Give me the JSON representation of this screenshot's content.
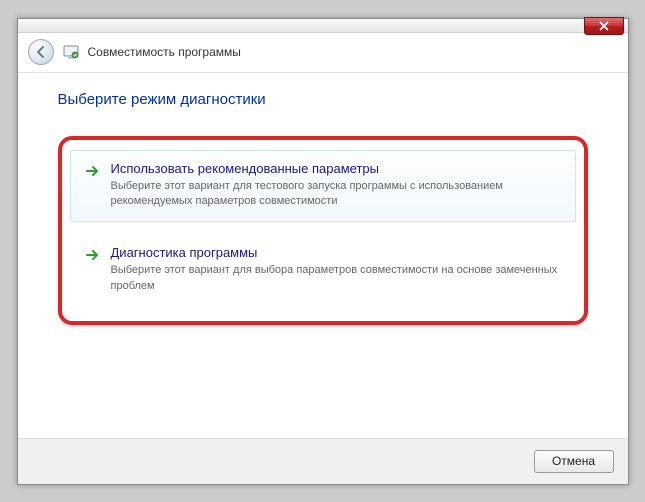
{
  "header": {
    "title": "Совместимость программы"
  },
  "page": {
    "title": "Выберите режим диагностики"
  },
  "options": [
    {
      "title": "Использовать рекомендованные параметры",
      "description": "Выберите этот вариант для тестового запуска программы с использованием рекомендуемых параметров совместимости"
    },
    {
      "title": "Диагностика программы",
      "description": "Выберите этот вариант для выбора параметров совместимости на основе замеченных проблем"
    }
  ],
  "footer": {
    "cancel_label": "Отмена"
  }
}
